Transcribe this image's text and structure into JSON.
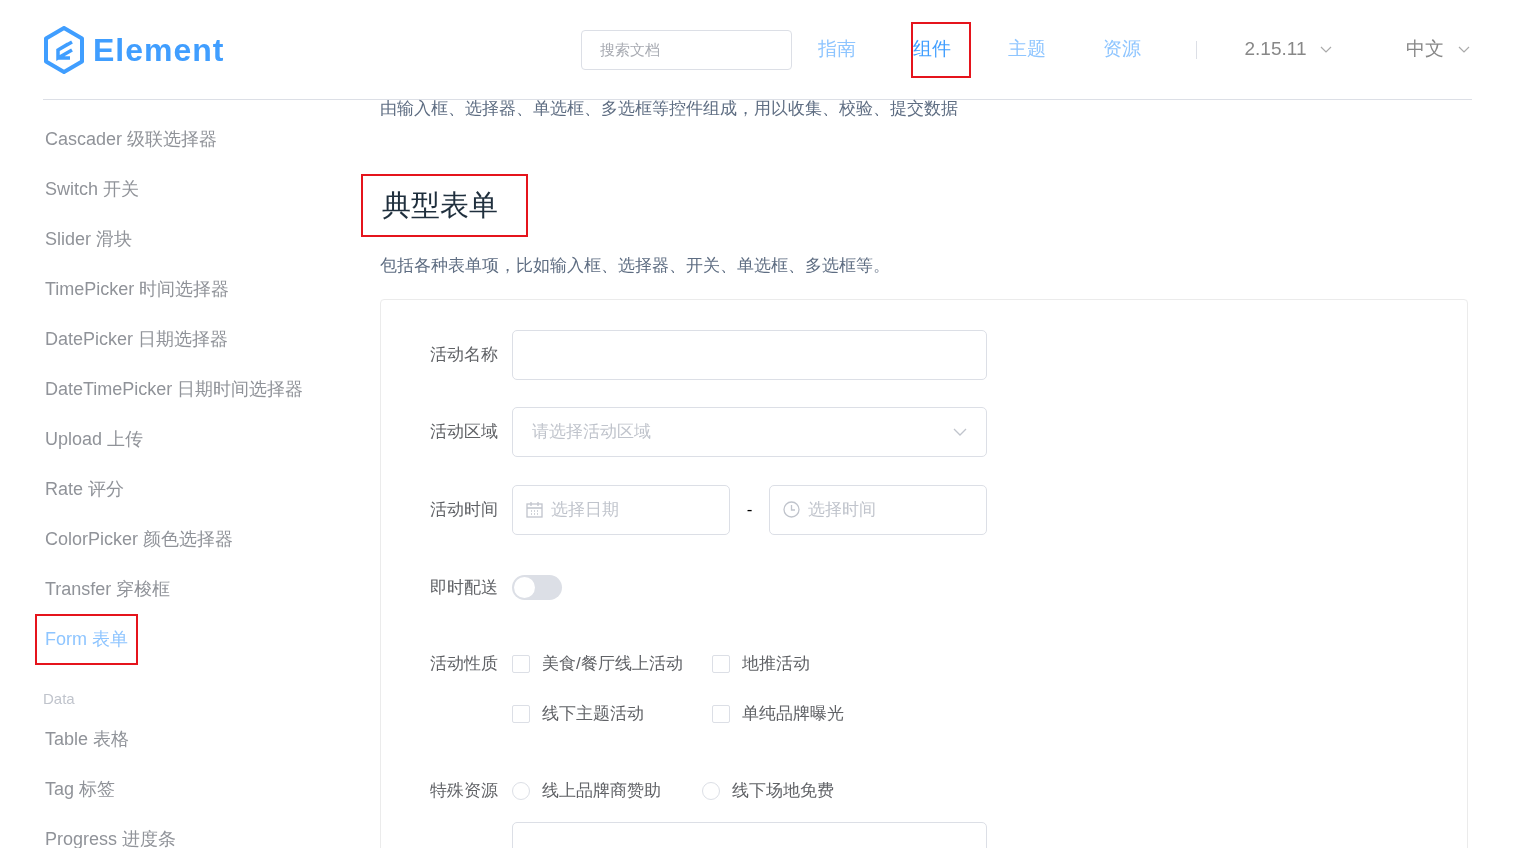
{
  "header": {
    "logo": "Element",
    "search": {
      "placeholder": "搜索文档"
    },
    "nav": [
      {
        "label": "指南",
        "selected": false,
        "highlighted": false
      },
      {
        "label": "组件",
        "selected": true,
        "highlighted": true
      },
      {
        "label": "主题",
        "selected": false,
        "highlighted": false
      },
      {
        "label": "资源",
        "selected": false,
        "highlighted": false
      }
    ],
    "version": "2.15.11",
    "language": "中文"
  },
  "sidebar": {
    "items": [
      {
        "kind": "item",
        "label": "Cascader 级联选择器",
        "selected": false,
        "highlighted": false
      },
      {
        "kind": "item",
        "label": "Switch 开关",
        "selected": false,
        "highlighted": false
      },
      {
        "kind": "item",
        "label": "Slider 滑块",
        "selected": false,
        "highlighted": false
      },
      {
        "kind": "item",
        "label": "TimePicker 时间选择器",
        "selected": false,
        "highlighted": false
      },
      {
        "kind": "item",
        "label": "DatePicker 日期选择器",
        "selected": false,
        "highlighted": false
      },
      {
        "kind": "item",
        "label": "DateTimePicker 日期时间选择器",
        "selected": false,
        "highlighted": false
      },
      {
        "kind": "item",
        "label": "Upload 上传",
        "selected": false,
        "highlighted": false
      },
      {
        "kind": "item",
        "label": "Rate 评分",
        "selected": false,
        "highlighted": false
      },
      {
        "kind": "item",
        "label": "ColorPicker 颜色选择器",
        "selected": false,
        "highlighted": false
      },
      {
        "kind": "item",
        "label": "Transfer 穿梭框",
        "selected": false,
        "highlighted": false
      },
      {
        "kind": "item",
        "label": "Form 表单",
        "selected": true,
        "highlighted": true
      },
      {
        "kind": "group",
        "label": "Data"
      },
      {
        "kind": "item",
        "label": "Table 表格",
        "selected": false,
        "highlighted": false
      },
      {
        "kind": "item",
        "label": "Tag 标签",
        "selected": false,
        "highlighted": false
      },
      {
        "kind": "item",
        "label": "Progress 进度条",
        "selected": false,
        "highlighted": false
      }
    ]
  },
  "content": {
    "intro": "由输入框、选择器、单选框、多选框等控件组成，用以收集、校验、提交数据",
    "section": {
      "heading": "典型表单",
      "highlighted": true,
      "description": "包括各种表单项，比如输入框、选择器、开关、单选框、多选框等。"
    },
    "form": [
      {
        "kind": "input",
        "label": "活动名称"
      },
      {
        "kind": "select",
        "label": "活动区域",
        "placeholder": "请选择活动区域"
      },
      {
        "kind": "datetime",
        "label": "活动时间",
        "date_placeholder": "选择日期",
        "separator": "-",
        "time_placeholder": "选择时间"
      },
      {
        "kind": "switch",
        "label": "即时配送",
        "on": false
      },
      {
        "kind": "checkboxes",
        "label": "活动性质",
        "options": [
          {
            "label": "美食/餐厅线上活动",
            "checked": false
          },
          {
            "label": "地推活动",
            "checked": false
          },
          {
            "label": "线下主题活动",
            "checked": false
          },
          {
            "label": "单纯品牌曝光",
            "checked": false
          }
        ]
      },
      {
        "kind": "radios",
        "label": "特殊资源",
        "options": [
          {
            "label": "线上品牌商赞助",
            "selected": false
          },
          {
            "label": "线下场地免费",
            "selected": false
          }
        ]
      },
      {
        "kind": "textarea"
      }
    ]
  }
}
